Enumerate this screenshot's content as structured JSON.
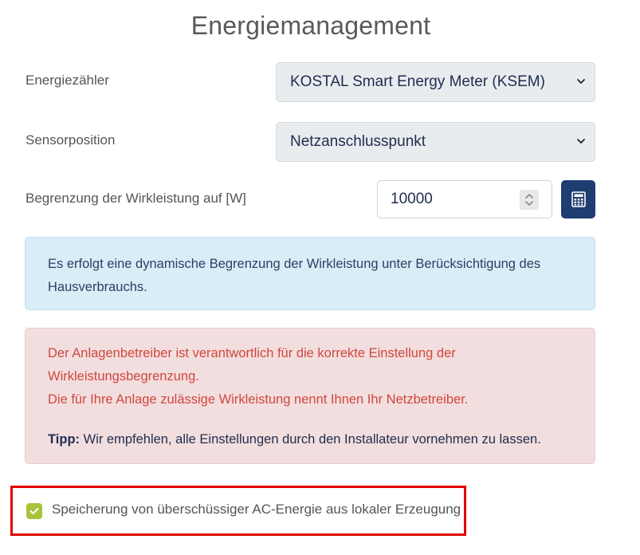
{
  "page": {
    "title": "Energiemanagement"
  },
  "energy_meter": {
    "label": "Energiezähler",
    "value": "KOSTAL Smart Energy Meter (KSEM)",
    "icon": "chevron-down-icon"
  },
  "sensor_position": {
    "label": "Sensorposition",
    "value": "Netzanschlusspunkt",
    "icon": "chevron-down-icon"
  },
  "power_limit": {
    "label": "Begrenzung der Wirkleistung auf [W]",
    "value": "10000",
    "calculator_icon": "calculator-icon"
  },
  "info_alert": {
    "line1": "Es erfolgt eine dynamische Begrenzung der Wirkleistung unter Berücksichtigung des",
    "line2": "Hausverbrauchs."
  },
  "warning_alert": {
    "line1": "Der Anlagenbetreiber ist verantwortlich für die korrekte Einstellung der",
    "line2": "Wirkleistungsbegrenzung.",
    "line3": "Die für Ihre Anlage zulässige Wirkleistung nennt Ihnen Ihr Netzbetreiber.",
    "tip_label": "Tipp:",
    "tip_text": " Wir empfehlen, alle Einstellungen durch den Installateur vornehmen zu lassen."
  },
  "ac_storage": {
    "label": "Speicherung von überschüssiger AC-Energie aus lokaler Erzeugung",
    "checked": true
  },
  "colors": {
    "accent_blue": "#1e3d71",
    "checkbox_green": "#a8c43a",
    "highlight_red": "#e00000",
    "warning_text": "#d0473f"
  }
}
